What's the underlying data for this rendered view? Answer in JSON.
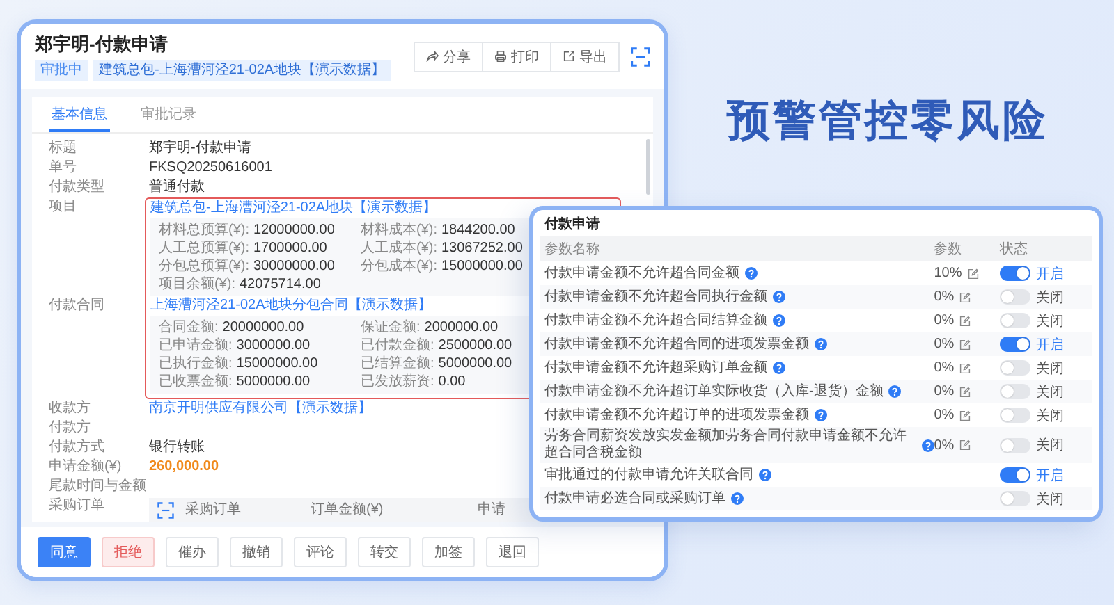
{
  "document": {
    "title": "郑宇明-付款申请",
    "status": "审批中",
    "project_tag": "建筑总包-上海漕河泾21-02A地块【演示数据】",
    "actions": [
      {
        "kind": "share",
        "label": "分享"
      },
      {
        "kind": "print",
        "label": "打印"
      },
      {
        "kind": "export",
        "label": "导出"
      },
      {
        "kind": "fullscreen"
      }
    ]
  },
  "tabs": [
    {
      "label": "基本信息",
      "selected": true
    },
    {
      "label": "审批记录",
      "selected": false
    }
  ],
  "fields": [
    {
      "kind": "text",
      "label": "标题",
      "value": "郑宇明-付款申请"
    },
    {
      "kind": "text",
      "label": "单号",
      "value": "FKSQ20250616001"
    },
    {
      "kind": "text",
      "label": "付款类型",
      "value": "普通付款"
    },
    {
      "kind": "link_group",
      "label": "项目",
      "value": "建筑总包-上海漕河泾21-02A地块【演示数据】",
      "highlighted": true,
      "details": [
        {
          "label": "材料总预算(¥):",
          "value": "12000000.00"
        },
        {
          "label": "材料成本(¥):",
          "value": "1844200.00"
        },
        {
          "label": "人工总预算(¥):",
          "value": "1700000.00"
        },
        {
          "label": "人工成本(¥):",
          "value": "13067252.00"
        },
        {
          "label": "分包总预算(¥):",
          "value": "30000000.00"
        },
        {
          "label": "分包成本(¥):",
          "value": "15000000.00"
        },
        {
          "label": "项目余额(¥):",
          "value": "42075714.00"
        }
      ]
    },
    {
      "kind": "link_group",
      "label": "付款合同",
      "value": "上海漕河泾21-02A地块分包合同【演示数据】",
      "highlighted": true,
      "details": [
        {
          "label": "合同金额:",
          "value": "20000000.00"
        },
        {
          "label": "保证金额:",
          "value": "2000000.00"
        },
        {
          "label": "已申请金额:",
          "value": "3000000.00"
        },
        {
          "label": "已付款金额:",
          "value": "2500000.00"
        },
        {
          "label": "已执行金额:",
          "value": "15000000.00"
        },
        {
          "label": "已结算金额:",
          "value": "5000000.00"
        },
        {
          "label": "已收票金额:",
          "value": "5000000.00"
        },
        {
          "label": "已发放薪资:",
          "value": "0.00"
        }
      ]
    },
    {
      "kind": "link",
      "label": "收款方",
      "value": "南京开明供应有限公司【演示数据】"
    },
    {
      "kind": "text",
      "label": "付款方"
    },
    {
      "kind": "text",
      "label": "付款方式",
      "value": "银行转账"
    },
    {
      "kind": "amount",
      "label": "申请金额(¥)",
      "value": "260,000.00"
    },
    {
      "kind": "text",
      "label": "尾款时间与金额"
    }
  ],
  "purchase_orders": {
    "label": "采购订单",
    "columns": [
      "采购订单",
      "订单金额(¥)",
      "申请"
    ]
  },
  "footer_buttons": [
    {
      "kind": "primary",
      "label": "同意"
    },
    {
      "kind": "danger",
      "label": "拒绝"
    },
    {
      "kind": "default",
      "label": "催办"
    },
    {
      "kind": "default",
      "label": "撤销"
    },
    {
      "kind": "default",
      "label": "评论"
    },
    {
      "kind": "default",
      "label": "转交"
    },
    {
      "kind": "default",
      "label": "加签"
    },
    {
      "kind": "default",
      "label": "退回"
    }
  ],
  "tagline": "预警管控零风险",
  "settings_panel": {
    "title": "付款申请",
    "columns": [
      "参数名称",
      "参数",
      "状态"
    ],
    "rows": [
      {
        "name": "付款申请金额不允许超合同金额",
        "param": "10%",
        "on": true,
        "state_label": "开启"
      },
      {
        "name": "付款申请金额不允许超合同执行金额",
        "param": "0%",
        "on": false,
        "state_label": "关闭"
      },
      {
        "name": "付款申请金额不允许超合同结算金额",
        "param": "0%",
        "on": false,
        "state_label": "关闭"
      },
      {
        "name": "付款申请金额不允许超合同的进项发票金额",
        "param": "0%",
        "on": true,
        "state_label": "开启"
      },
      {
        "name": "付款申请金额不允许超采购订单金额",
        "param": "0%",
        "on": false,
        "state_label": "关闭"
      },
      {
        "name": "付款申请金额不允许超订单实际收货（入库-退货）金额",
        "param": "0%",
        "on": false,
        "state_label": "关闭"
      },
      {
        "name": "付款申请金额不允许超订单的进项发票金额",
        "param": "0%",
        "on": false,
        "state_label": "关闭"
      },
      {
        "name": "劳务合同薪资发放实发金额加劳务合同付款申请金额不允许超合同含税金额",
        "param": "0%",
        "on": false,
        "state_label": "关闭"
      },
      {
        "name": "审批通过的付款申请允许关联合同",
        "on": true,
        "state_label": "开启"
      },
      {
        "name": "付款申请必选合同或采购订单",
        "on": false,
        "state_label": "关闭"
      }
    ]
  }
}
